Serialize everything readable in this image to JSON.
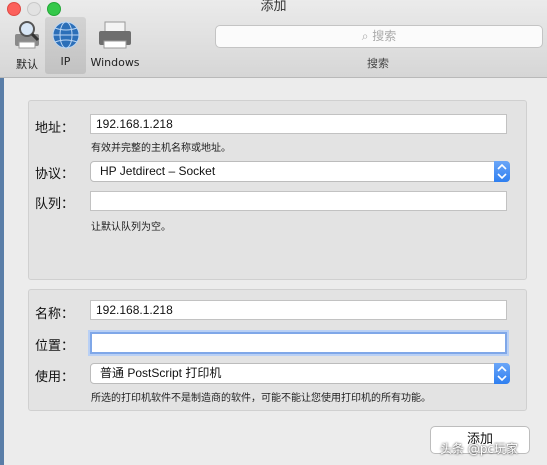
{
  "window": {
    "title": "添加"
  },
  "toolbar": {
    "items": [
      {
        "label": "默认",
        "icon": "default-printer-icon"
      },
      {
        "label": "IP",
        "icon": "globe-icon",
        "selected": true
      },
      {
        "label": "Windows",
        "icon": "windows-printer-icon"
      }
    ],
    "search": {
      "placeholder": "搜索",
      "label": "搜索"
    }
  },
  "form_top": {
    "address": {
      "label": "地址：",
      "value": "192.168.1.218",
      "hint": "有效并完整的主机名称或地址。"
    },
    "protocol": {
      "label": "协议：",
      "value": "HP Jetdirect – Socket"
    },
    "queue": {
      "label": "队列：",
      "value": "",
      "hint": "让默认队列为空。"
    }
  },
  "form_bottom": {
    "name": {
      "label": "名称：",
      "value": "192.168.1.218"
    },
    "location": {
      "label": "位置：",
      "value": ""
    },
    "use": {
      "label": "使用：",
      "value": "普通 PostScript 打印机",
      "hint": "所选的打印机软件不是制造商的软件，可能不能让您使用打印机的所有功能。"
    }
  },
  "footer": {
    "add_button": "添加",
    "watermark": "头条 @pc玩家"
  },
  "colors": {
    "accent": "#2f7ff0",
    "close": "#fc605b",
    "zoom": "#34c84a"
  }
}
